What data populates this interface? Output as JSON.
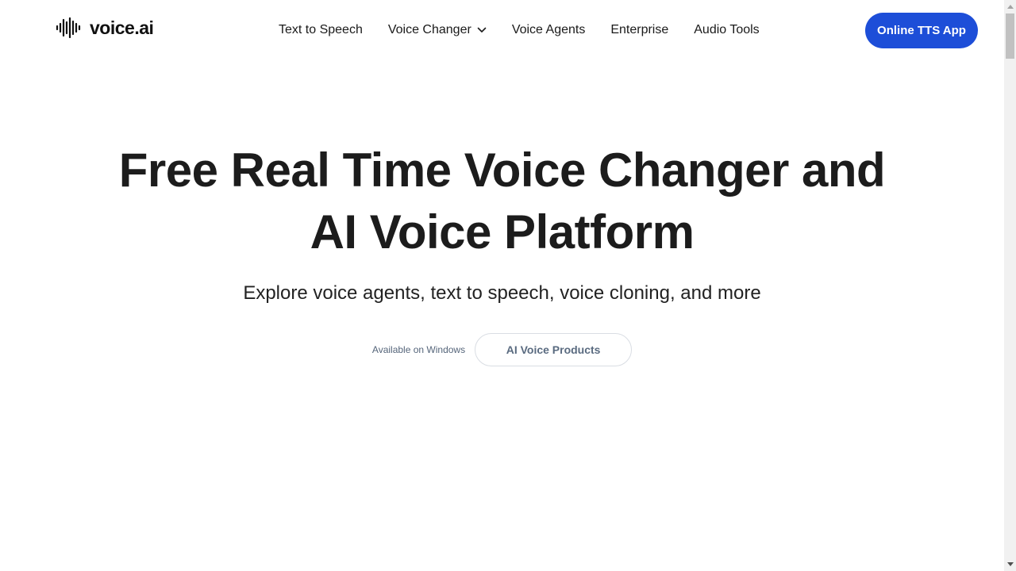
{
  "header": {
    "logo": {
      "text": "voice.ai",
      "icon": "waveform-icon"
    },
    "nav": [
      {
        "label": "Text to Speech"
      },
      {
        "label": "Voice Changer",
        "icon": "chevron-down-icon"
      },
      {
        "label": "Voice Agents"
      },
      {
        "label": "Enterprise"
      },
      {
        "label": "Audio Tools"
      }
    ],
    "cta_label": "Online TTS App"
  },
  "hero": {
    "title_line1": "Free Real Time Voice Changer and",
    "title_line2": "AI Voice Platform",
    "subtitle": "Explore voice agents, text to speech, voice cloning, and more",
    "available_label": "Available on Windows",
    "products_button_label": "AI Voice Products"
  },
  "colors": {
    "accent": "#1d4ed8",
    "text": "#1c1c1c",
    "muted": "#55657a",
    "background": "#ffffff"
  }
}
